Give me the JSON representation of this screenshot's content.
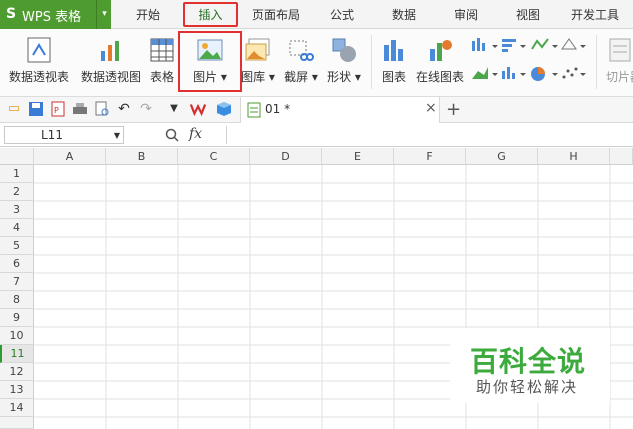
{
  "app": {
    "logo_letter": "S",
    "title": "WPS 表格",
    "menu_arrow": "▾"
  },
  "menu_tabs": [
    "开始",
    "插入",
    "页面布局",
    "公式",
    "数据",
    "审阅",
    "视图",
    "开发工具"
  ],
  "active_tab": "插入",
  "ribbon": {
    "buttons": [
      "数据透视表",
      "数据透视图",
      "表格",
      "图片 ▾",
      "图库 ▾",
      "截屏 ▾",
      "形状 ▾",
      "图表",
      "在线图表",
      "切片器"
    ]
  },
  "document": {
    "tab_name": "01 *",
    "close": "×",
    "new_tab": "+"
  },
  "formula_bar": {
    "cell_ref": "L11",
    "fx": "fx",
    "formula": ""
  },
  "sheet": {
    "columns": [
      "A",
      "B",
      "C",
      "D",
      "E",
      "F",
      "G",
      "H"
    ],
    "rows": [
      "1",
      "2",
      "3",
      "4",
      "5",
      "6",
      "7",
      "8",
      "9",
      "10",
      "11",
      "12",
      "13",
      "14"
    ],
    "active_row": "11"
  },
  "watermark": {
    "title": "百科全说",
    "subtitle": "助你轻松解决"
  },
  "colors": {
    "brand_green": "#4e9b2f",
    "highlight_red": "#e03030",
    "watermark_green": "#3daa3d"
  }
}
